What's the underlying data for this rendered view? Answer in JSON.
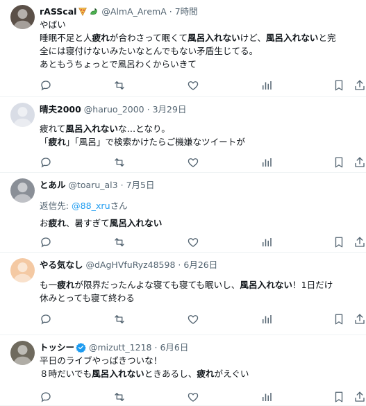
{
  "tweets": [
    {
      "name": "rASScal",
      "handle": "@AlmA_AremA",
      "sep": "·",
      "time": "7時間",
      "lines": [
        [
          {
            "t": "やばい",
            "b": false
          }
        ],
        [
          {
            "t": "睡眠不足と人",
            "b": false
          },
          {
            "t": "疲れ",
            "b": true
          },
          {
            "t": "が合わさって眠くて",
            "b": false
          },
          {
            "t": "風呂入れない",
            "b": true
          },
          {
            "t": "けど、",
            "b": false
          },
          {
            "t": "風呂入れない",
            "b": true
          },
          {
            "t": "と完",
            "b": false
          }
        ],
        [
          {
            "t": "全には寝付けないみたいなとんでもない矛盾生じてる。",
            "b": false
          }
        ],
        [
          {
            "t": "あともうちょっとで風呂わくからいきて",
            "b": false
          }
        ]
      ]
    },
    {
      "name": "晴夫2000",
      "handle": "@haruo_2000",
      "sep": "·",
      "time": "3月29日",
      "lines": [
        [
          {
            "t": "疲れて",
            "b": false
          },
          {
            "t": "風呂入れない",
            "b": true
          },
          {
            "t": "な…となり。",
            "b": false
          }
        ],
        [
          {
            "t": "「",
            "b": false
          },
          {
            "t": "疲れ",
            "b": true
          },
          {
            "t": "」「風呂」で検索かけたらご機嫌なツイートが",
            "b": false
          }
        ]
      ]
    },
    {
      "name": "とあル",
      "handle": "@toaru_al3",
      "sep": "·",
      "time": "7月5日",
      "reply_label": "返信先:",
      "reply_mention": "@88_xru",
      "reply_suffix": "さん",
      "lines": [
        [
          {
            "t": "お",
            "b": false
          },
          {
            "t": "疲れ",
            "b": true
          },
          {
            "t": "、暑すぎて",
            "b": false
          },
          {
            "t": "風呂入れない",
            "b": true
          }
        ]
      ]
    },
    {
      "name": "やる気なし",
      "handle": "@dAgHVfuRyz48598",
      "sep": "·",
      "time": "6月26日",
      "lines": [
        [
          {
            "t": "も一",
            "b": false
          },
          {
            "t": "疲れ",
            "b": true
          },
          {
            "t": "が限界だったんよな寝ても寝ても眠いし、",
            "b": false
          },
          {
            "t": "風呂入れない",
            "b": true
          },
          {
            "t": "！1日だけ",
            "b": false
          }
        ],
        [
          {
            "t": "休みとっても寝て終わる",
            "b": false
          }
        ]
      ]
    },
    {
      "name": "トッシー",
      "handle": "@mizutt_1218",
      "sep": "·",
      "time": "6月6日",
      "lines": [
        [
          {
            "t": "平日のライブやっぱきついな！",
            "b": false
          }
        ],
        [
          {
            "t": "８時だいでも",
            "b": false
          },
          {
            "t": "風呂入れない",
            "b": true
          },
          {
            "t": "ときあるし、",
            "b": false
          },
          {
            "t": "疲れ",
            "b": true
          },
          {
            "t": "がえぐい",
            "b": false
          }
        ]
      ]
    }
  ],
  "icons": {
    "actions": [
      "reply-icon",
      "retweet-icon",
      "like-icon",
      "views-icon",
      "bookmark-icon",
      "share-icon"
    ],
    "badges": [
      "pizza-emoji",
      "dragon-emoji",
      "verified-badge-icon"
    ]
  },
  "colors": {
    "text": "#0f1419",
    "muted": "#536471",
    "link": "#1d9bf0",
    "divider": "#eff3f4"
  }
}
